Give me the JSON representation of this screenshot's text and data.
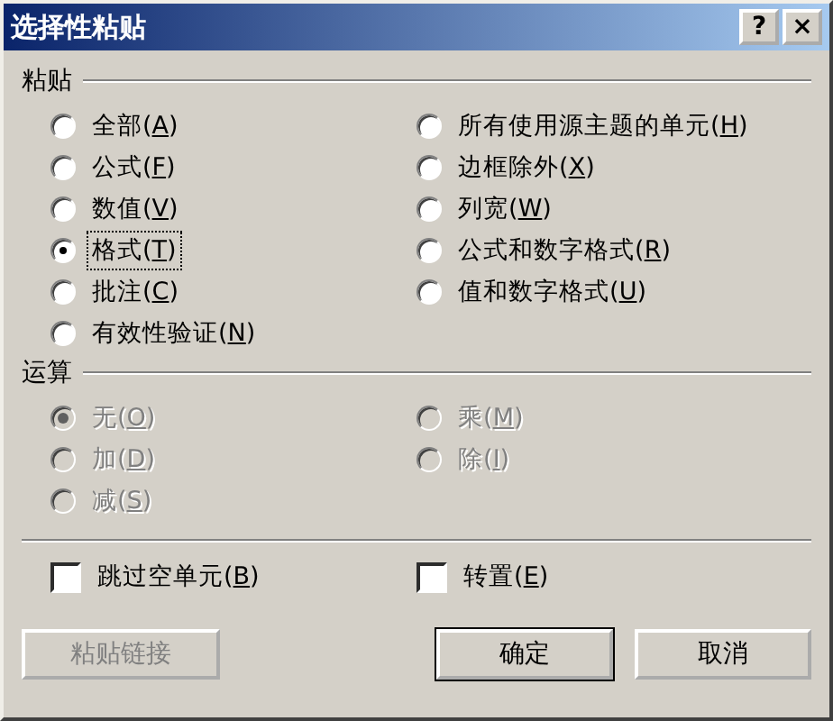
{
  "window": {
    "title": "选择性粘贴",
    "buttons": [
      "?",
      "×"
    ]
  },
  "paste": {
    "label": "粘贴",
    "columns": [
      [
        {
          "label": "全部(A)",
          "selected": false,
          "focused": false,
          "disabled": false
        },
        {
          "label": "公式(F)",
          "selected": false,
          "focused": false,
          "disabled": false
        },
        {
          "label": "数值(V)",
          "selected": false,
          "focused": false,
          "disabled": false
        },
        {
          "label": "格式(T)",
          "selected": true,
          "focused": true,
          "disabled": false
        },
        {
          "label": "批注(C)",
          "selected": false,
          "focused": false,
          "disabled": false
        },
        {
          "label": "有效性验证(N)",
          "selected": false,
          "focused": false,
          "disabled": false
        }
      ],
      [
        {
          "label": "所有使用源主题的单元(H)",
          "selected": false,
          "focused": false,
          "disabled": false
        },
        {
          "label": "边框除外(X)",
          "selected": false,
          "focused": false,
          "disabled": false
        },
        {
          "label": "列宽(W)",
          "selected": false,
          "focused": false,
          "disabled": false
        },
        {
          "label": "公式和数字格式(R)",
          "selected": false,
          "focused": false,
          "disabled": false
        },
        {
          "label": "值和数字格式(U)",
          "selected": false,
          "focused": false,
          "disabled": false
        }
      ]
    ]
  },
  "operation": {
    "label": "运算",
    "columns": [
      [
        {
          "label": "无(O)",
          "selected": true,
          "focused": false,
          "disabled": true
        },
        {
          "label": "加(D)",
          "selected": false,
          "focused": false,
          "disabled": true
        },
        {
          "label": "减(S)",
          "selected": false,
          "focused": false,
          "disabled": true
        }
      ],
      [
        {
          "label": "乘(M)",
          "selected": false,
          "focused": false,
          "disabled": true
        },
        {
          "label": "除(I)",
          "selected": false,
          "focused": false,
          "disabled": true
        }
      ]
    ]
  },
  "checkboxes": [
    {
      "label": "跳过空单元(B)",
      "checked": false
    },
    {
      "label": "转置(E)",
      "checked": false
    }
  ],
  "buttons": [
    {
      "label": "粘贴链接",
      "kind": "link"
    },
    {
      "label": "确定",
      "kind": "default"
    },
    {
      "label": "取消",
      "kind": "normal"
    }
  ]
}
